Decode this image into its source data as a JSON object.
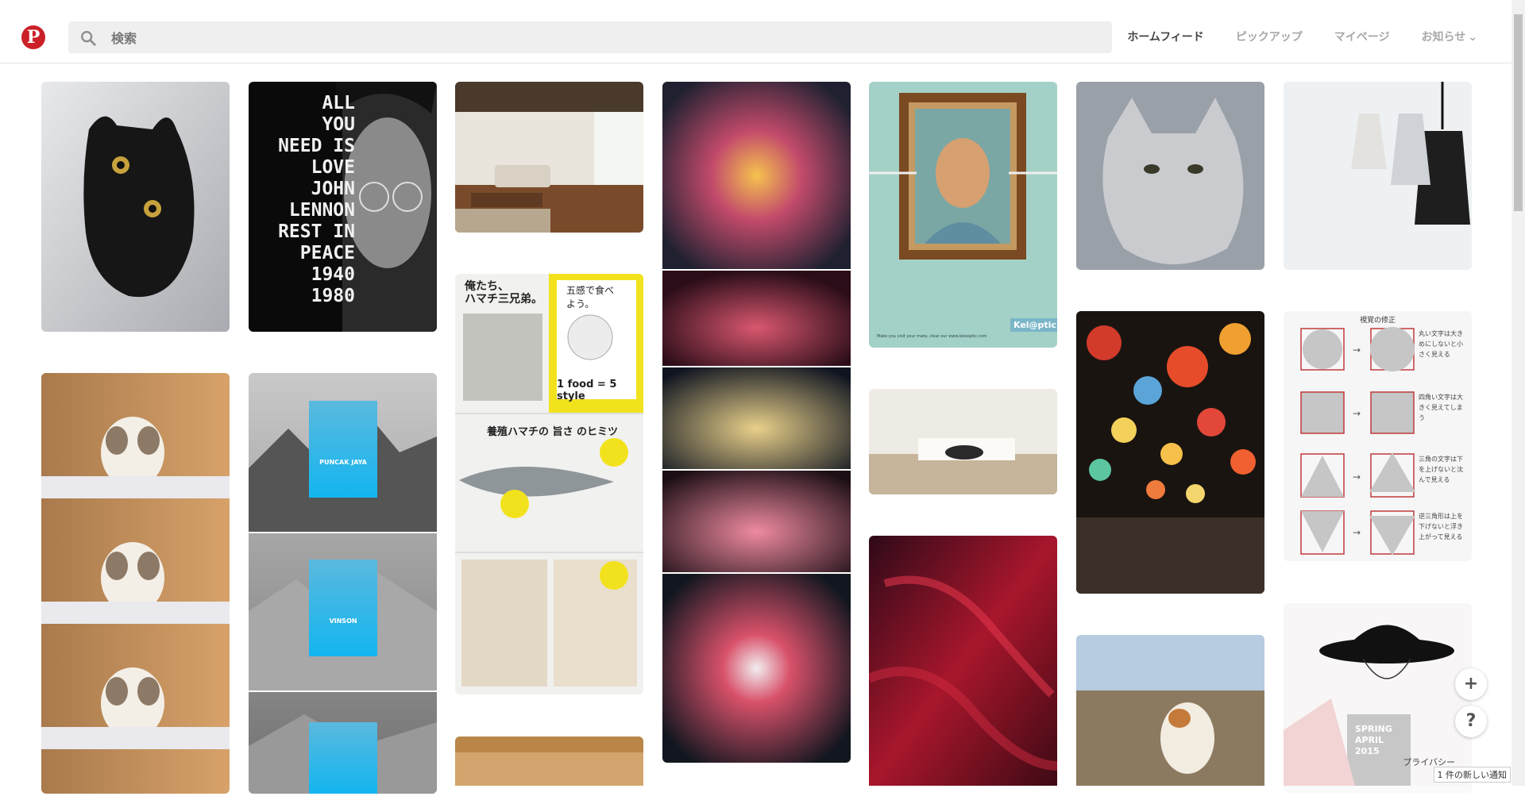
{
  "header": {
    "search_placeholder": "検索",
    "nav": [
      "ホームフィード",
      "ピックアップ",
      "マイページ",
      "お知らせ"
    ],
    "active_nav": "ホームフィード",
    "brand_color": "#cb2027"
  },
  "pins": {
    "lennon": {
      "lines": [
        "ALL",
        "YOU",
        "NEED IS",
        "LOVE",
        "JOHN",
        "LENNON",
        "REST IN",
        "PEACE",
        "1940",
        "1980"
      ]
    },
    "mountain1": {
      "label": "PUNCAK JAYA"
    },
    "mountain2": {
      "label": "VINSON"
    },
    "magazine": {
      "headline1": "俺たち、",
      "headline2": "ハマチ三兄弟。",
      "tagline": "五感で食べよう。",
      "brand": "1 food = 5 style",
      "section": "養殖ハマチの 旨さ のヒミツ"
    },
    "vangogh": {
      "logo": "Kel@ptic",
      "caption": "Make you visit your mate, clear our www.kelooptic.com"
    },
    "shapes": {
      "title": "視覚の修正",
      "notes": [
        "丸い文字は大きめにしないと小さく見える",
        "四角い文字は大きく見えてしまう",
        "三角の文字は下を上げないと沈んで見える",
        "逆三角形は上を下げないと浮き上がって見える"
      ]
    },
    "manga": {
      "text": "SPRING APRIL 2015"
    }
  },
  "footer": {
    "privacy": "プライバシー",
    "notification": "1 件の新しい通知"
  },
  "fab": {
    "add": "+",
    "help": "?"
  }
}
